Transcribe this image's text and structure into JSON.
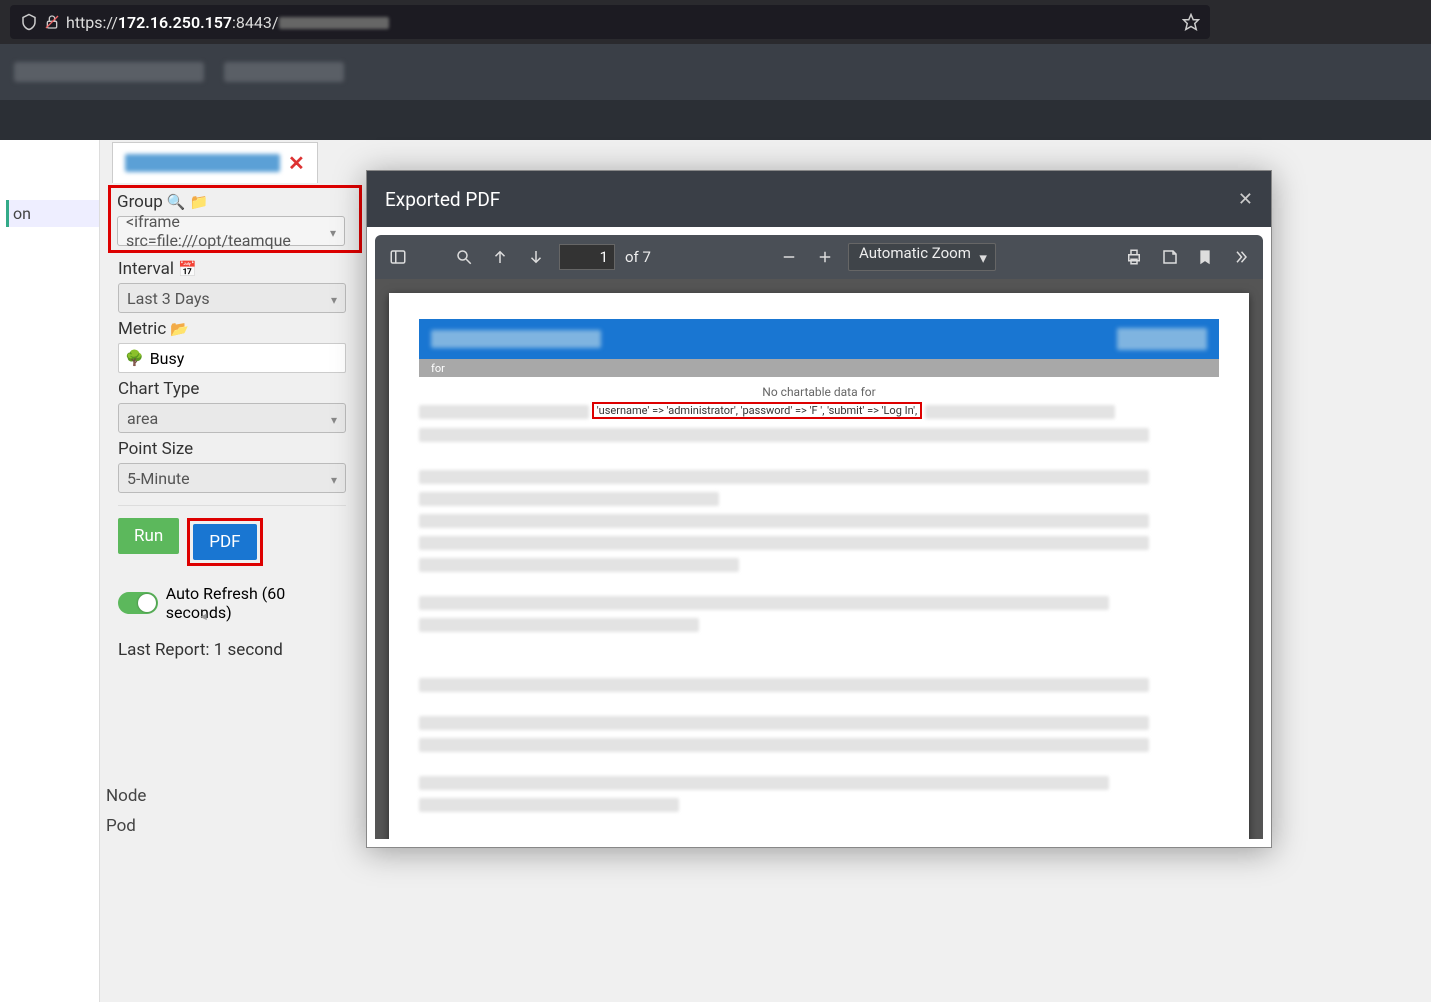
{
  "browser": {
    "url_prefix": "https://",
    "url_host": "172.16.250.157",
    "url_rest": ":8443/",
    "star_title": "Bookmark this page"
  },
  "left_nav": {
    "item1": "on",
    "bottom_item1": "Node",
    "bottom_item2": "Pod"
  },
  "tab": {
    "close_title": "Close tab"
  },
  "form": {
    "group_label": "Group",
    "group_value": "<iframe src=file:///opt/teamque",
    "interval_label": "Interval",
    "interval_value": "Last 3 Days",
    "metric_label": "Metric",
    "metric_value": "Busy",
    "chart_type_label": "Chart Type",
    "chart_type_value": "area",
    "point_size_label": "Point Size",
    "point_size_value": "5-Minute",
    "run_label": "Run",
    "pdf_label": "PDF",
    "autorefresh_label": "Auto Refresh (60 seconds)",
    "last_report": "Last Report: 1 second"
  },
  "modal": {
    "title": "Exported PDF",
    "close_title": "Close"
  },
  "pdf_toolbar": {
    "page_current": "1",
    "page_of": "of 7",
    "zoom_mode": "Automatic Zoom"
  },
  "pdf_content": {
    "header_for": "for",
    "no_data": "No chartable data for",
    "leak_text": "'username' => 'administrator', 'password' => 'F                ', 'submit' => 'Log In',"
  }
}
